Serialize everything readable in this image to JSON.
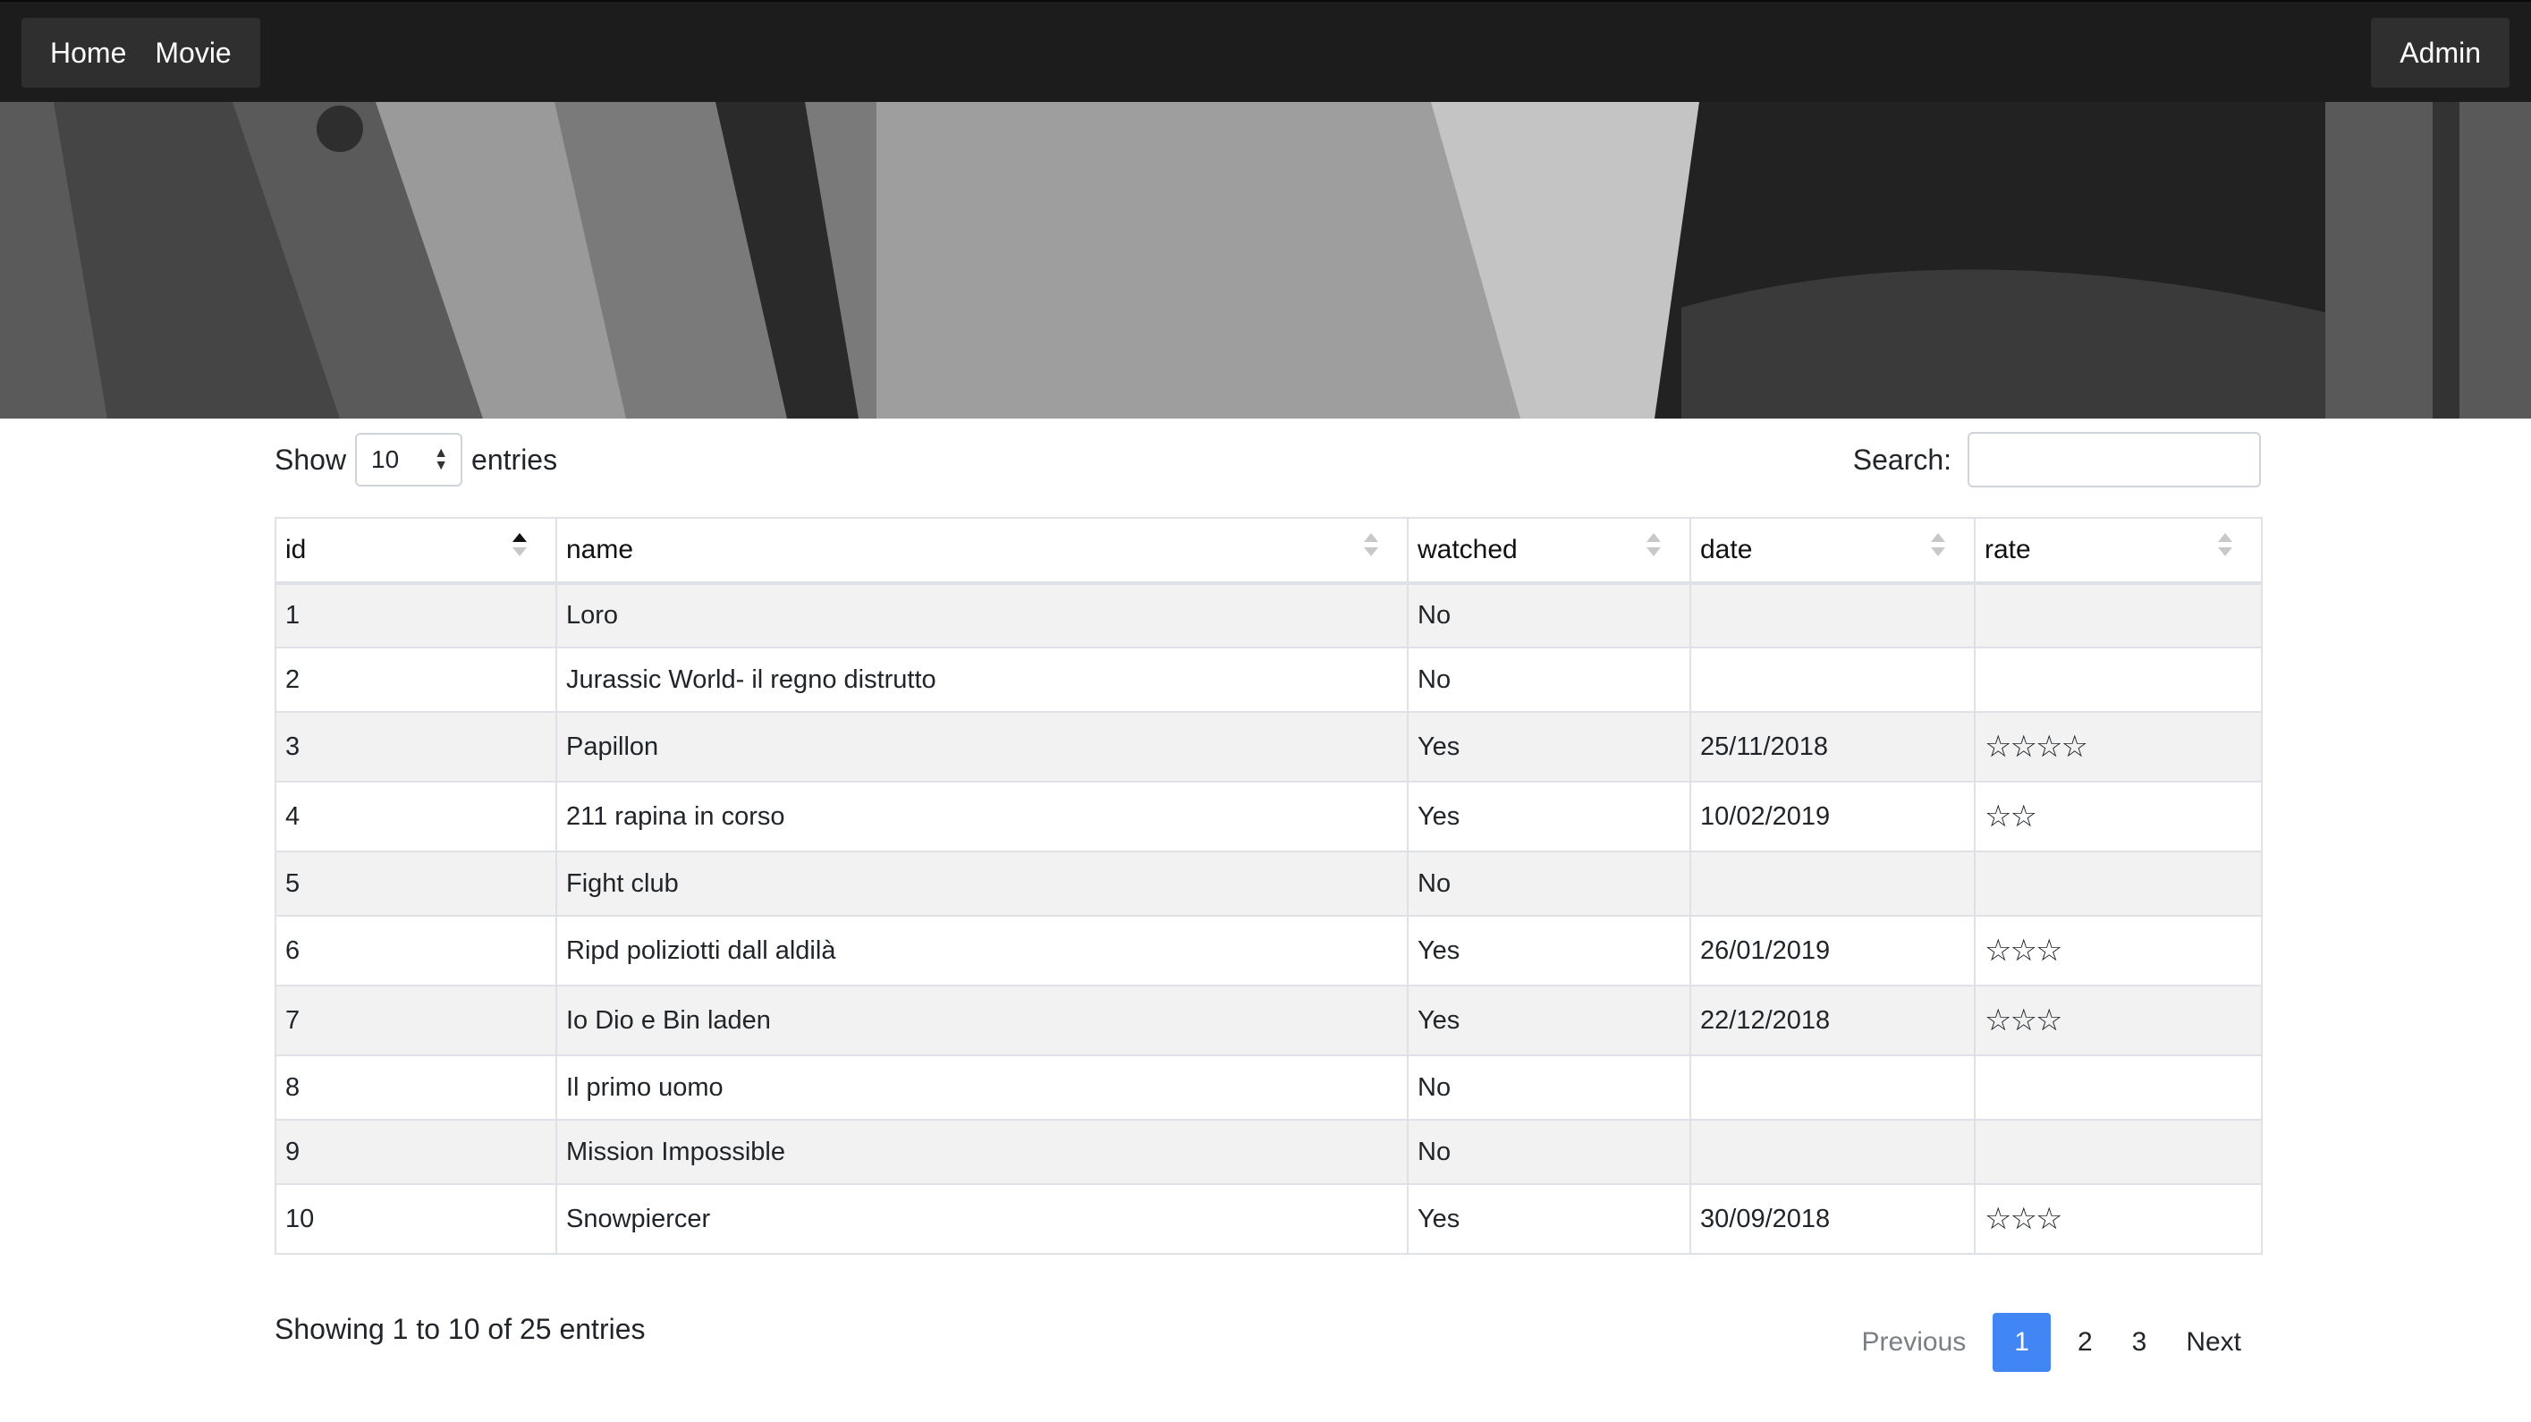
{
  "nav": {
    "home_label": "Home",
    "movie_label": "Movie",
    "admin_label": "Admin"
  },
  "controls": {
    "show_label": "Show",
    "entries_value": "10",
    "entries_label": "entries",
    "search_label": "Search:",
    "search_placeholder": ""
  },
  "table": {
    "columns": [
      "id",
      "name",
      "watched",
      "date",
      "rate"
    ],
    "sorted_column": "id",
    "rows": [
      {
        "id": "1",
        "name": "Loro",
        "watched": "No",
        "date": "",
        "rate": ""
      },
      {
        "id": "2",
        "name": "Jurassic World- il regno distrutto",
        "watched": "No",
        "date": "",
        "rate": ""
      },
      {
        "id": "3",
        "name": "Papillon",
        "watched": "Yes",
        "date": "25/11/2018",
        "rate": "☆☆☆☆"
      },
      {
        "id": "4",
        "name": "211 rapina in corso",
        "watched": "Yes",
        "date": "10/02/2019",
        "rate": "☆☆"
      },
      {
        "id": "5",
        "name": "Fight club",
        "watched": "No",
        "date": "",
        "rate": ""
      },
      {
        "id": "6",
        "name": "Ripd poliziotti dall aldilà",
        "watched": "Yes",
        "date": "26/01/2019",
        "rate": "☆☆☆"
      },
      {
        "id": "7",
        "name": "Io Dio e Bin laden",
        "watched": "Yes",
        "date": "22/12/2018",
        "rate": "☆☆☆"
      },
      {
        "id": "8",
        "name": "Il primo uomo",
        "watched": "No",
        "date": "",
        "rate": ""
      },
      {
        "id": "9",
        "name": "Mission Impossible",
        "watched": "No",
        "date": "",
        "rate": ""
      },
      {
        "id": "10",
        "name": "Snowpiercer",
        "watched": "Yes",
        "date": "30/09/2018",
        "rate": "☆☆☆"
      }
    ]
  },
  "footer": {
    "info": "Showing 1 to 10 of 25 entries",
    "previous_label": "Previous",
    "pages": [
      "1",
      "2",
      "3"
    ],
    "current_page": "1",
    "next_label": "Next"
  },
  "colors": {
    "navbar": "#1c1c1c",
    "accent": "#4285f4"
  }
}
